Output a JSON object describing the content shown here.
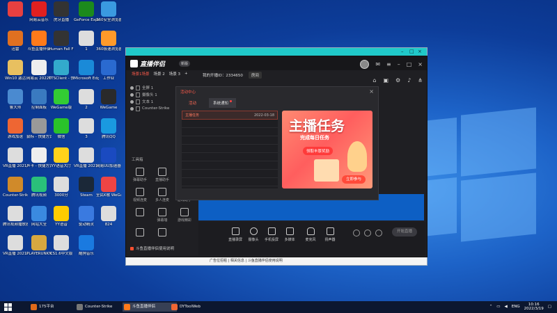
{
  "desktop_icons": [
    {
      "label": "",
      "color": "#e84040"
    },
    {
      "label": "网易云音乐",
      "color": "#e02020"
    },
    {
      "label": "虎牙直播",
      "color": "#333"
    },
    {
      "label": "GeForce Experience",
      "color": "#1c8a1c"
    },
    {
      "label": "360安全浏览器",
      "color": "#3a9ae0"
    },
    {
      "label": "迅雷",
      "color": "#e07020"
    },
    {
      "label": "斗鱼直播伴侣",
      "color": "#ff7a1a"
    },
    {
      "label": "Human Fall Flat",
      "color": "#333"
    },
    {
      "label": "1",
      "color": "#ddd"
    },
    {
      "label": "360极速浏览器",
      "color": "#ff9a2a"
    },
    {
      "label": "Win10 激活",
      "color": "#e8c060"
    },
    {
      "label": "网易云 20220114",
      "color": "#eee"
    },
    {
      "label": "TTSClient - 快捷方式",
      "color": "#3ac"
    },
    {
      "label": "Microsoft Edge",
      "color": "#1a8ad8"
    },
    {
      "label": "工作业",
      "color": "#2a6ad0"
    },
    {
      "label": "鲁大师",
      "color": "#4a8ad0"
    },
    {
      "label": "控制面板",
      "color": "#3a7ac0"
    },
    {
      "label": "WeGame版",
      "color": "#3c3"
    },
    {
      "label": "2",
      "color": "#ddd"
    },
    {
      "label": "WeGame",
      "color": "#2a2a2a"
    },
    {
      "label": "游戏加速",
      "color": "#e63"
    },
    {
      "label": "鼠标 - 快捷方式",
      "color": "#999"
    },
    {
      "label": "微信",
      "color": "#2ac32a"
    },
    {
      "label": "3",
      "color": "#ddd"
    },
    {
      "label": "腾讯QQ",
      "color": "#1a9ae0"
    },
    {
      "label": "VR直播 20211026",
      "color": "#ddd"
    },
    {
      "label": "声卡 - 快捷方式",
      "color": "#eee"
    },
    {
      "label": "YY语音大厅",
      "color": "#ffd21a"
    },
    {
      "label": "VR直播 20211116",
      "color": "#ddd"
    },
    {
      "label": "网易UU加速器",
      "color": "#1a4ac0"
    },
    {
      "label": "Counter-Strike",
      "color": "#d08a2a"
    },
    {
      "label": "腾讯视频",
      "color": "#2ac07a"
    },
    {
      "label": "3000分",
      "color": "#ddd"
    },
    {
      "label": "Steam",
      "color": "#1b2838"
    },
    {
      "label": "全民K歌 WeGame版",
      "color": "#e44"
    },
    {
      "label": "腾讯视频播放器",
      "color": "#ddd"
    },
    {
      "label": "网站大全",
      "color": "#3a8ae0"
    },
    {
      "label": "YY语音",
      "color": "#ffcc00"
    },
    {
      "label": "驱动精灵",
      "color": "#3a7ae0"
    },
    {
      "label": "824",
      "color": "#ddd"
    },
    {
      "label": "VR直播 20210920",
      "color": "#ddd"
    },
    {
      "label": "PLAYERUNKNOWN'S BATTLEGROUNDS",
      "color": "#d8a840"
    },
    {
      "label": "CS1.6中文版",
      "color": "#ddd"
    },
    {
      "label": "酷狗音乐",
      "color": "#1a7ae0"
    }
  ],
  "app": {
    "name": "直播伴侣",
    "new_badge": "新版",
    "scene_tabs": [
      "场景1场景",
      "场景 2",
      "场景 3",
      "+"
    ],
    "room_label": "我的开播ID：2334650",
    "room_btn": "房间",
    "sources": [
      "全屏 1",
      "摄像头 1",
      "文本 1",
      "Counter-Strike"
    ],
    "tools_title": "工具箱",
    "tools": [
      "弹幕助手",
      "直播助手",
      "",
      "视频连麦",
      "多人连麦",
      "游戏助手",
      "",
      "弹幕墙",
      "游戏精彩",
      "",
      ""
    ],
    "notice": "斗鱼直播伴侣使用说明",
    "controls": [
      "直播录屏",
      "摄像头",
      "手机投屏",
      "多媒体",
      "麦克风",
      "扬声器"
    ],
    "start_button": "开始直播"
  },
  "dialog": {
    "title": "活动中心",
    "tabs": [
      "活动",
      "系统通知"
    ],
    "items": [
      {
        "name": "主播任务",
        "date": "2022-03-18"
      },
      {
        "name": "",
        "date": ""
      },
      {
        "name": "",
        "date": ""
      },
      {
        "name": "",
        "date": ""
      },
      {
        "name": "",
        "date": ""
      },
      {
        "name": "",
        "date": ""
      },
      {
        "name": "",
        "date": ""
      },
      {
        "name": "",
        "date": ""
      },
      {
        "name": "",
        "date": ""
      }
    ],
    "banner_title": "主播任务",
    "banner_sub": "完成每日任务",
    "banner_pill": "领取丰厚奖励",
    "banner_cta": "立即参与"
  },
  "bg_window": {
    "row_text": "广告位招租 | 相关信息 | 斗鱼直播伴侣使用说明"
  },
  "taskbar": {
    "items": [
      {
        "label": "175平台",
        "color": "#e06a1a"
      },
      {
        "label": "Counter-Strike",
        "color": "#777"
      },
      {
        "label": "斗鱼直播伴侣",
        "color": "#ff7a1a"
      },
      {
        "label": "DYToolWeb",
        "color": "#e63"
      }
    ],
    "lang": "ENG",
    "time": "10:16",
    "date": "2022/3/19"
  }
}
